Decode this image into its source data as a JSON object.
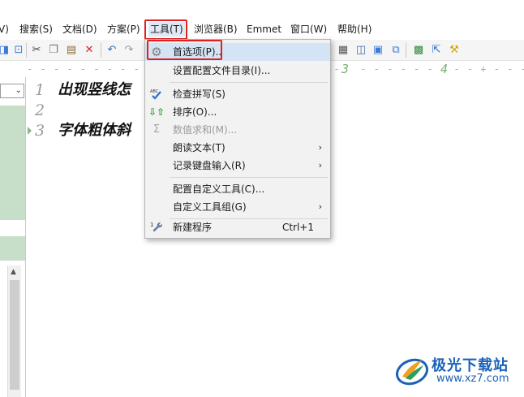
{
  "menubar": {
    "items": [
      {
        "label": "V)"
      },
      {
        "label": "搜索(S)"
      },
      {
        "label": "文档(D)"
      },
      {
        "label": "方案(P)"
      },
      {
        "label": "工具(T)"
      },
      {
        "label": "浏览器(B)"
      },
      {
        "label": "Emmet"
      },
      {
        "label": "窗口(W)"
      },
      {
        "label": "帮助(H)"
      }
    ],
    "active_item": "工具(T)"
  },
  "toolbar": {
    "icons": [
      "format-icon",
      "cut-icon",
      "copy-icon",
      "paste-icon",
      "delete-icon",
      "undo-icon",
      "redo-icon",
      "column-mode-icon",
      "split-view-icon",
      "file-list-icon",
      "browser-icon",
      "save-all-icon",
      "help-cursor-icon",
      "tools-icon"
    ]
  },
  "ruler": {
    "marks": [
      "3",
      "4"
    ]
  },
  "editor": {
    "lines": [
      {
        "number": "1",
        "text": "出现竖线怎"
      },
      {
        "number": "2",
        "text": ""
      },
      {
        "number": "3",
        "text": "字体粗体斜"
      }
    ]
  },
  "tools_menu": {
    "items": [
      {
        "label": "首选项(P)..",
        "icon": "gear-icon",
        "state": "hover"
      },
      {
        "label": "设置配置文件目录(I)...",
        "icon": "",
        "state": "normal"
      },
      {
        "label": "检查拼写(S)",
        "icon": "spellcheck-icon",
        "state": "normal"
      },
      {
        "label": "排序(O)...",
        "icon": "sort-icon",
        "state": "normal"
      },
      {
        "label": "数值求和(M)...",
        "icon": "sigma-icon",
        "state": "disabled"
      },
      {
        "label": "朗读文本(T)",
        "icon": "",
        "state": "normal",
        "submenu": "›"
      },
      {
        "label": "记录键盘输入(R)",
        "icon": "",
        "state": "normal",
        "submenu": "›"
      },
      {
        "label": "配置自定义工具(C)...",
        "icon": "",
        "state": "normal"
      },
      {
        "label": "自定义工具组(G)",
        "icon": "",
        "state": "normal",
        "submenu": "›"
      },
      {
        "label": "新建程序",
        "icon": "wrench-icon",
        "icon_badge": "1",
        "state": "normal",
        "shortcut": "Ctrl+1"
      }
    ]
  },
  "watermark": {
    "title": "极光下载站",
    "url": "www.xz7.com"
  },
  "colors": {
    "highlight_box": "#e02020",
    "menu_hover": "#d5e4f4",
    "panel_green": "#c7dfc9",
    "watermark_blue": "#1a62b8"
  }
}
